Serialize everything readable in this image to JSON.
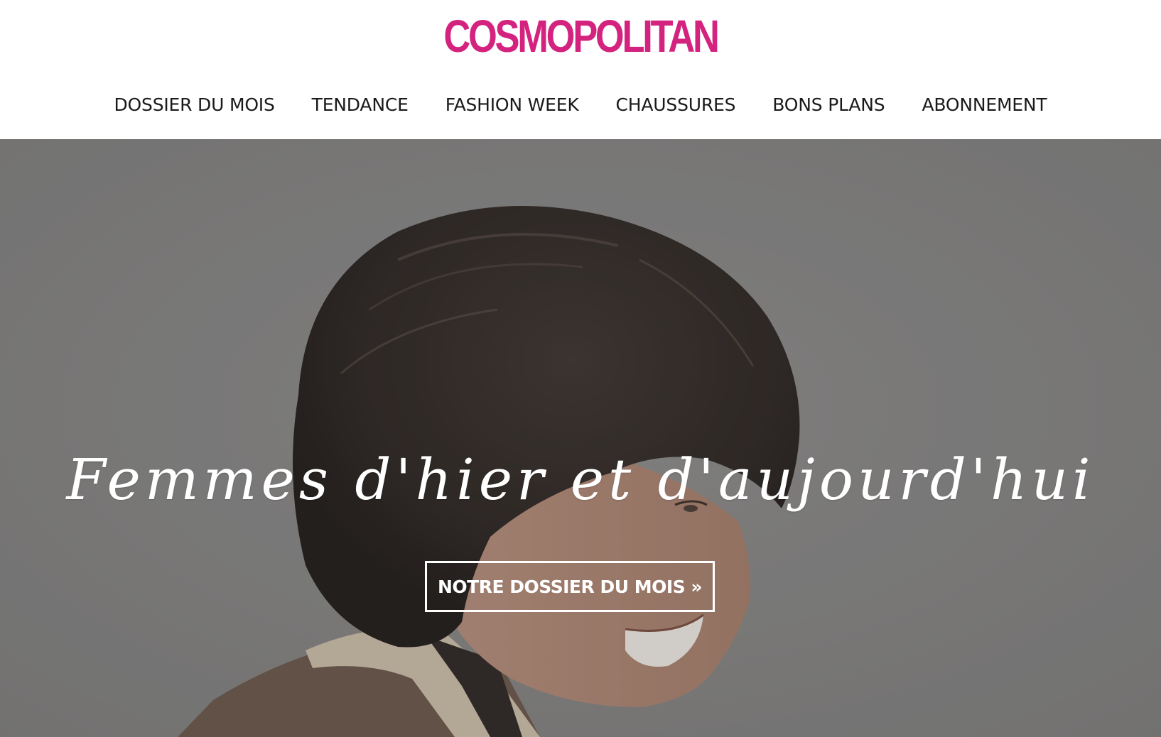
{
  "header": {
    "logo_text": "COSMOPOLITAN",
    "nav": [
      {
        "label": "DOSSIER DU MOIS"
      },
      {
        "label": "TENDANCE"
      },
      {
        "label": "FASHION WEEK"
      },
      {
        "label": "CHAUSSURES"
      },
      {
        "label": "BONS PLANS"
      },
      {
        "label": "ABONNEMENT"
      }
    ]
  },
  "hero": {
    "title": "Femmes d'hier et d'aujourd'hui",
    "cta_label": "NOTRE DOSSIER DU MOIS »"
  },
  "colors": {
    "brand": "#d4237f",
    "nav_text": "#1a1a1a",
    "hero_background": "#8a8988",
    "hero_text": "#ffffff"
  }
}
